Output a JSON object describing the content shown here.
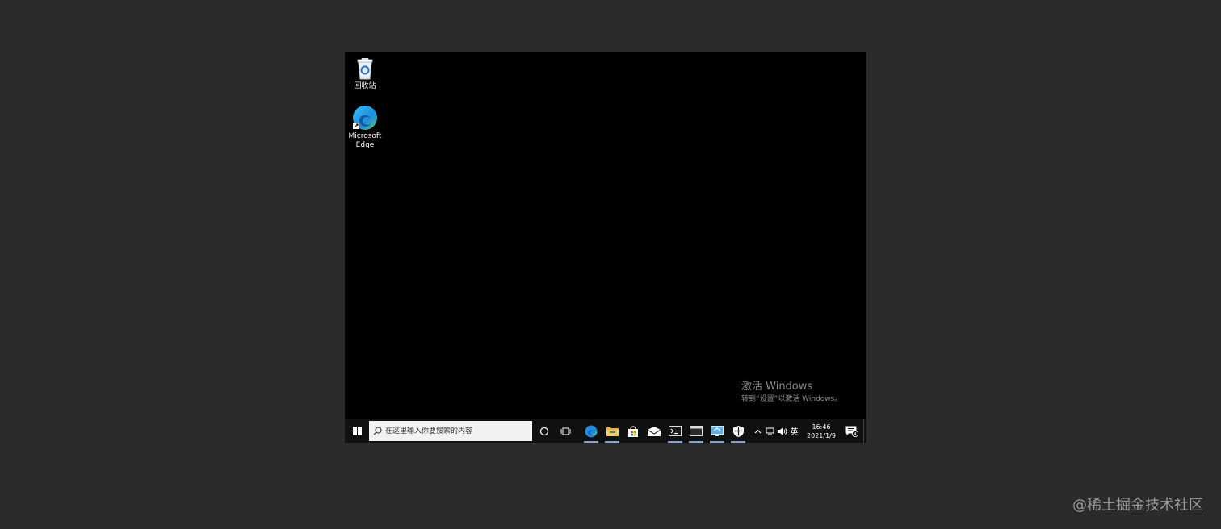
{
  "desktop": {
    "icons": [
      {
        "label": "回收站",
        "icon": "recycle-bin-icon"
      },
      {
        "label_line1": "Microsoft",
        "label_line2": "Edge",
        "icon": "edge-icon"
      }
    ]
  },
  "activation": {
    "title": "激活 Windows",
    "subtitle": "转到“设置”以激活 Windows。"
  },
  "taskbar": {
    "search_placeholder": "在这里输入你要搜索的内容",
    "apps": [
      "edge-icon",
      "file-explorer-icon",
      "store-icon",
      "mail-icon",
      "terminal-icon",
      "window-app-icon",
      "remote-desktop-icon",
      "security-icon"
    ],
    "tray": {
      "language": "英",
      "time": "16:46",
      "date": "2021/1/9",
      "notification_count": "4"
    }
  },
  "site_watermark": "@稀土掘金技术社区",
  "colors": {
    "desktop_bg": "#000000",
    "page_bg": "#2b2b2b",
    "taskbar_bg": "#101010",
    "running_indicator": "#7aa7d9"
  }
}
